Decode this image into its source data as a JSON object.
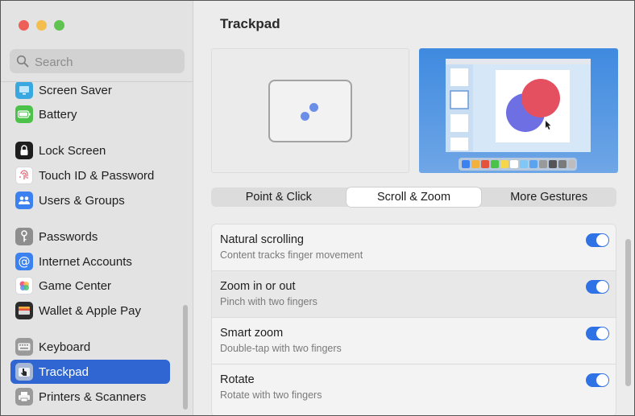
{
  "search": {
    "placeholder": "Search"
  },
  "sidebar": {
    "items": [
      {
        "label": "Screen Saver",
        "icon": "screen-saver-icon",
        "color": "#3aa8e0"
      },
      {
        "label": "Battery",
        "icon": "battery-icon",
        "color": "#4cc24a"
      },
      {
        "label": "Lock Screen",
        "icon": "lock-icon",
        "color": "#1e1e1e"
      },
      {
        "label": "Touch ID & Password",
        "icon": "fingerprint-icon",
        "color": "#ffffff"
      },
      {
        "label": "Users & Groups",
        "icon": "users-icon",
        "color": "#3b82f0"
      },
      {
        "label": "Passwords",
        "icon": "key-icon",
        "color": "#8e8e8e"
      },
      {
        "label": "Internet Accounts",
        "icon": "at-icon",
        "color": "#3b82f0"
      },
      {
        "label": "Game Center",
        "icon": "game-center-icon",
        "color": "#ffffff"
      },
      {
        "label": "Wallet & Apple Pay",
        "icon": "wallet-icon",
        "color": "#2c2c2c"
      },
      {
        "label": "Keyboard",
        "icon": "keyboard-icon",
        "color": "#9a9a9a"
      },
      {
        "label": "Trackpad",
        "icon": "trackpad-icon",
        "color": "#9a9a9a",
        "selected": true
      },
      {
        "label": "Printers & Scanners",
        "icon": "printer-icon",
        "color": "#9a9a9a"
      }
    ]
  },
  "main": {
    "title": "Trackpad",
    "tabs": [
      {
        "label": "Point & Click",
        "active": false
      },
      {
        "label": "Scroll & Zoom",
        "active": true
      },
      {
        "label": "More Gestures",
        "active": false
      }
    ],
    "settings": [
      {
        "title": "Natural scrolling",
        "subtitle": "Content tracks finger movement",
        "enabled": true
      },
      {
        "title": "Zoom in or out",
        "subtitle": "Pinch with two fingers",
        "enabled": true
      },
      {
        "title": "Smart zoom",
        "subtitle": "Double-tap with two fingers",
        "enabled": true
      },
      {
        "title": "Rotate",
        "subtitle": "Rotate with two fingers",
        "enabled": true
      }
    ]
  },
  "colors": {
    "accent": "#2f72e6",
    "selected": "#2f66d1"
  }
}
